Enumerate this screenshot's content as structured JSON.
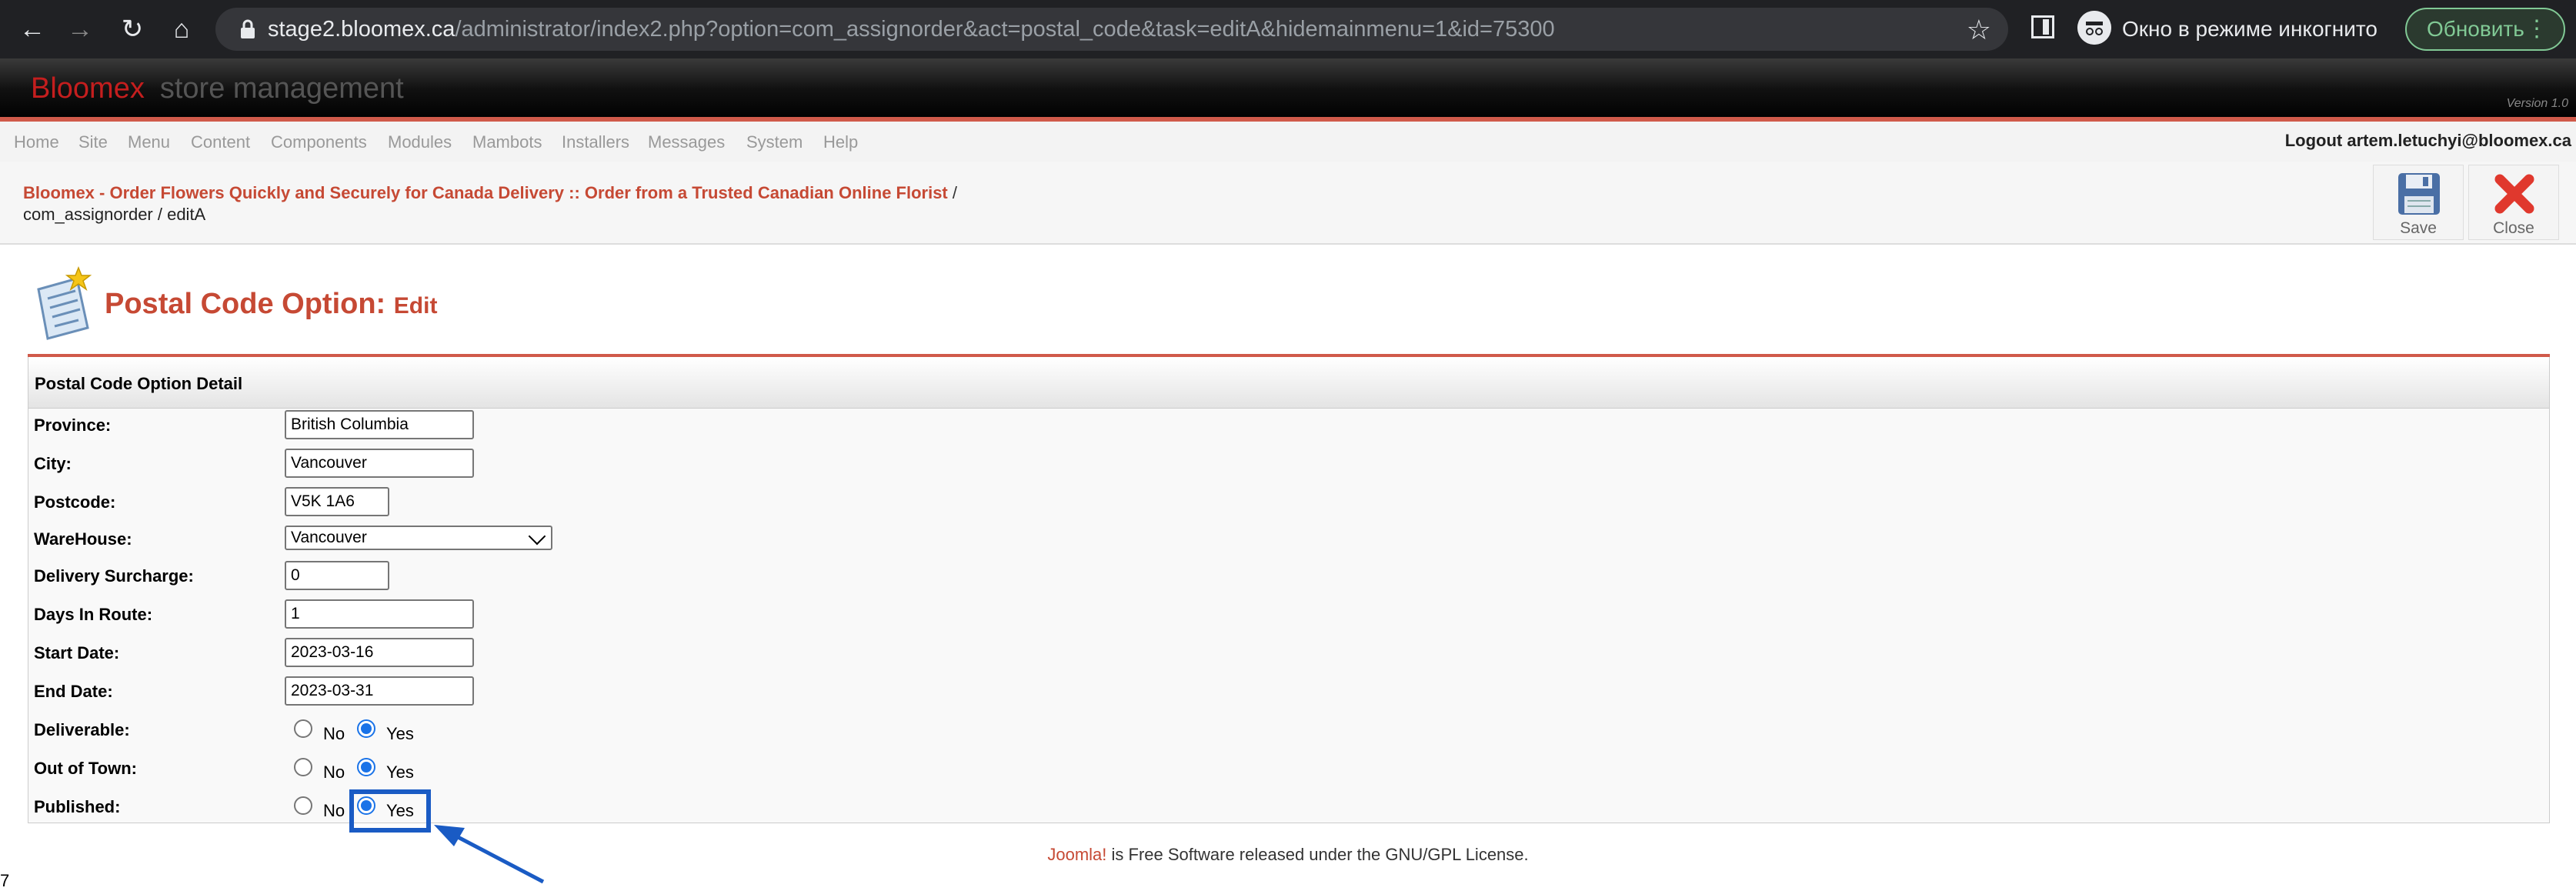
{
  "browser": {
    "url_host": "stage2.bloomex.ca",
    "url_path": "/administrator/index2.php?option=com_assignorder&act=postal_code&task=editA&hidemainmenu=1&id=75300",
    "incognito_label": "Окно в режиме инкогнито",
    "update_label": "Обновить"
  },
  "header": {
    "brand": "Bloomex",
    "subtitle": "store management",
    "version": "Version 1.0"
  },
  "menu": {
    "items": [
      "Home",
      "Site",
      "Menu",
      "Content",
      "Components",
      "Modules",
      "Mambots",
      "Installers",
      "Messages",
      "System",
      "Help"
    ],
    "logout": "Logout artem.letuchyi@bloomex.ca"
  },
  "breadcrumb": {
    "site_link": "Bloomex - Order Flowers Quickly and Securely for Canada Delivery :: Order from a Trusted Canadian Online Florist",
    "sep": "/",
    "path": "com_assignorder / editA"
  },
  "toolbar": {
    "save_label": "Save",
    "close_label": "Close"
  },
  "page": {
    "title": "Postal Code Option:",
    "title_suffix": "Edit"
  },
  "form": {
    "heading": "Postal Code Option Detail",
    "province_label": "Province:",
    "province_value": "British Columbia",
    "city_label": "City:",
    "city_value": "Vancouver",
    "postcode_label": "Postcode:",
    "postcode_value": "V5K 1A6",
    "warehouse_label": "WareHouse:",
    "warehouse_value": "Vancouver",
    "surcharge_label": "Delivery Surcharge:",
    "surcharge_value": "0",
    "days_label": "Days In Route:",
    "days_value": "1",
    "start_label": "Start Date:",
    "start_value": "2023-03-16",
    "end_label": "End Date:",
    "end_value": "2023-03-31",
    "deliverable_label": "Deliverable:",
    "outoftown_label": "Out of Town:",
    "published_label": "Published:",
    "no_label": "No",
    "yes_label": "Yes",
    "deliverable": "Yes",
    "out_of_town": "Yes",
    "published": "Yes"
  },
  "footer": {
    "joomla": "Joomla!",
    "text": " is Free Software released under the GNU/GPL License."
  },
  "stray_text": "7"
}
